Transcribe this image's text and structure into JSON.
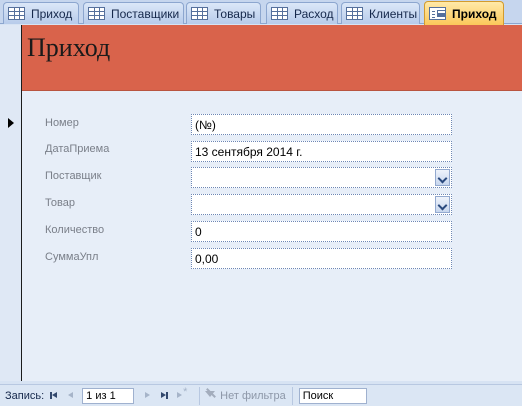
{
  "tabs": [
    {
      "label": "Приход",
      "icon": "table-icon",
      "active": false
    },
    {
      "label": "Поставщики",
      "icon": "table-icon",
      "active": false
    },
    {
      "label": "Товары",
      "icon": "table-icon",
      "active": false
    },
    {
      "label": "Расход",
      "icon": "table-icon",
      "active": false
    },
    {
      "label": "Клиенты",
      "icon": "table-icon",
      "active": false
    },
    {
      "label": "Приход",
      "icon": "form-icon",
      "active": true
    }
  ],
  "form": {
    "title": "Приход",
    "header_color": "#d9634b",
    "fields": [
      {
        "label": "Номер",
        "value": "(№)",
        "type": "text"
      },
      {
        "label": "ДатаПриема",
        "value": "13 сентября 2014 г.",
        "type": "text"
      },
      {
        "label": "Поставщик",
        "value": "",
        "type": "combo"
      },
      {
        "label": "Товар",
        "value": "",
        "type": "combo"
      },
      {
        "label": "Количество",
        "value": "0",
        "type": "text"
      },
      {
        "label": "СуммаУпл",
        "value": "0,00",
        "type": "text"
      }
    ]
  },
  "navbar": {
    "record_label": "Запись:",
    "record_position": "1 из 1",
    "filter_label": "Нет фильтра",
    "search_value": "Поиск"
  }
}
